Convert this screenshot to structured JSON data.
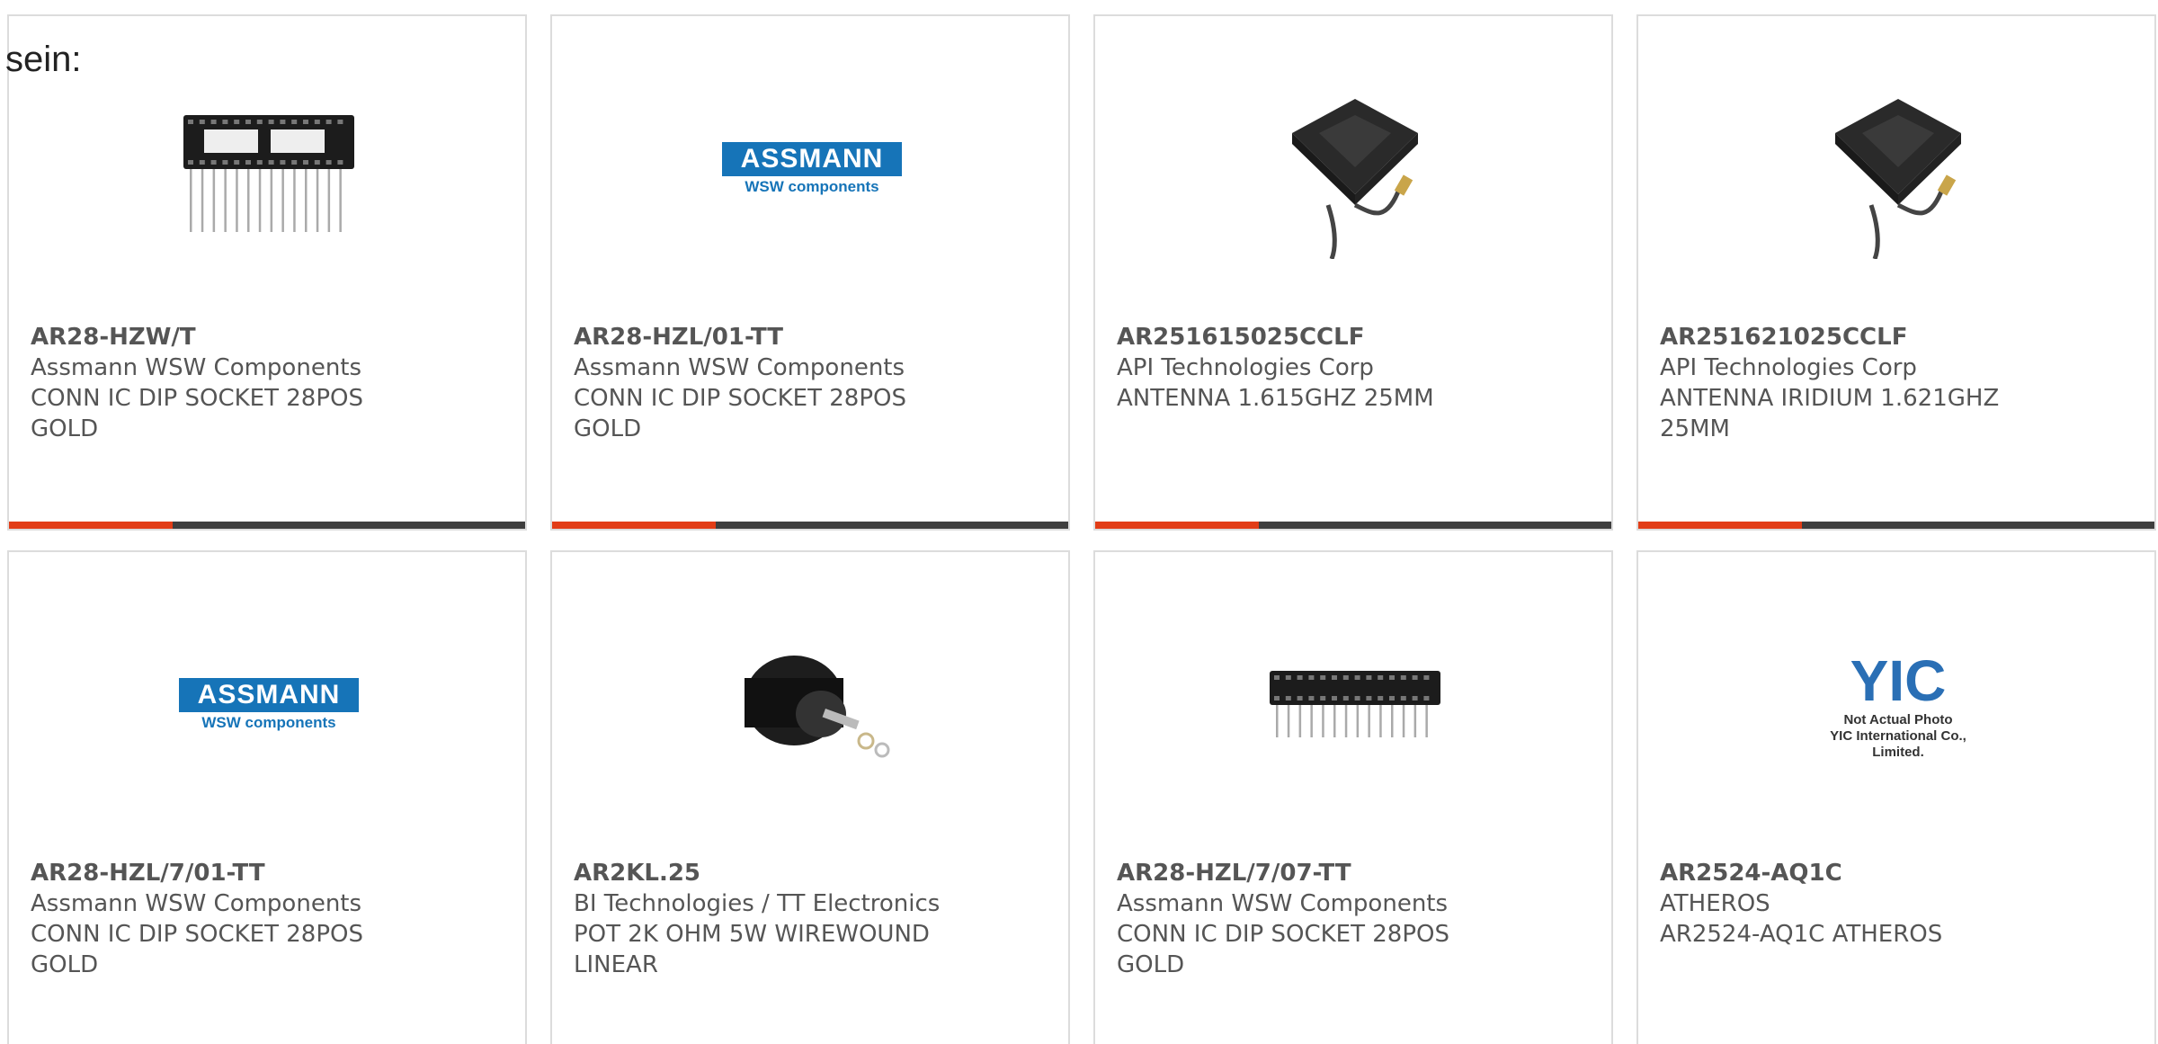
{
  "lead_text": "sein:",
  "products": [
    {
      "pn": "AR28-HZW/T",
      "maker": "Assmann WSW Components",
      "desc": "CONN IC DIP SOCKET 28POS GOLD",
      "image": "dip-socket-wide"
    },
    {
      "pn": "AR28-HZL/01-TT",
      "maker": "Assmann WSW Components",
      "desc": "CONN IC DIP SOCKET 28POS GOLD",
      "image": "assmann-logo"
    },
    {
      "pn": "AR251615025CCLF",
      "maker": "API Technologies Corp",
      "desc": "ANTENNA 1.615GHZ 25MM",
      "image": "patch-antenna"
    },
    {
      "pn": "AR251621025CCLF",
      "maker": "API Technologies Corp",
      "desc": "ANTENNA IRIDIUM 1.621GHZ 25MM",
      "image": "patch-antenna"
    },
    {
      "pn": "AR28-HZL/7/01-TT",
      "maker": "Assmann WSW Components",
      "desc": "CONN IC DIP SOCKET 28POS GOLD",
      "image": "assmann-logo"
    },
    {
      "pn": "AR2KL.25",
      "maker": "BI Technologies / TT Electronics",
      "desc": "POT 2K OHM 5W WIREWOUND LINEAR",
      "image": "potentiometer"
    },
    {
      "pn": "AR28-HZL/7/07-TT",
      "maker": "Assmann WSW Components",
      "desc": "CONN IC DIP SOCKET 28POS GOLD",
      "image": "dip-socket-narrow"
    },
    {
      "pn": "AR2524-AQ1C",
      "maker": "ATHEROS",
      "desc": "AR2524-AQ1C ATHEROS",
      "image": "yic-placeholder"
    }
  ],
  "logo": {
    "brand": "ASSMANN",
    "sub": "WSW components"
  },
  "yic": {
    "mark": "YIC",
    "line1": "Not Actual Photo",
    "line2": "YIC International Co., Limited."
  },
  "colors": {
    "accent": "#e23d17",
    "bar": "#3e3e3e",
    "text": "#555555",
    "brand_blue": "#1674b8"
  }
}
